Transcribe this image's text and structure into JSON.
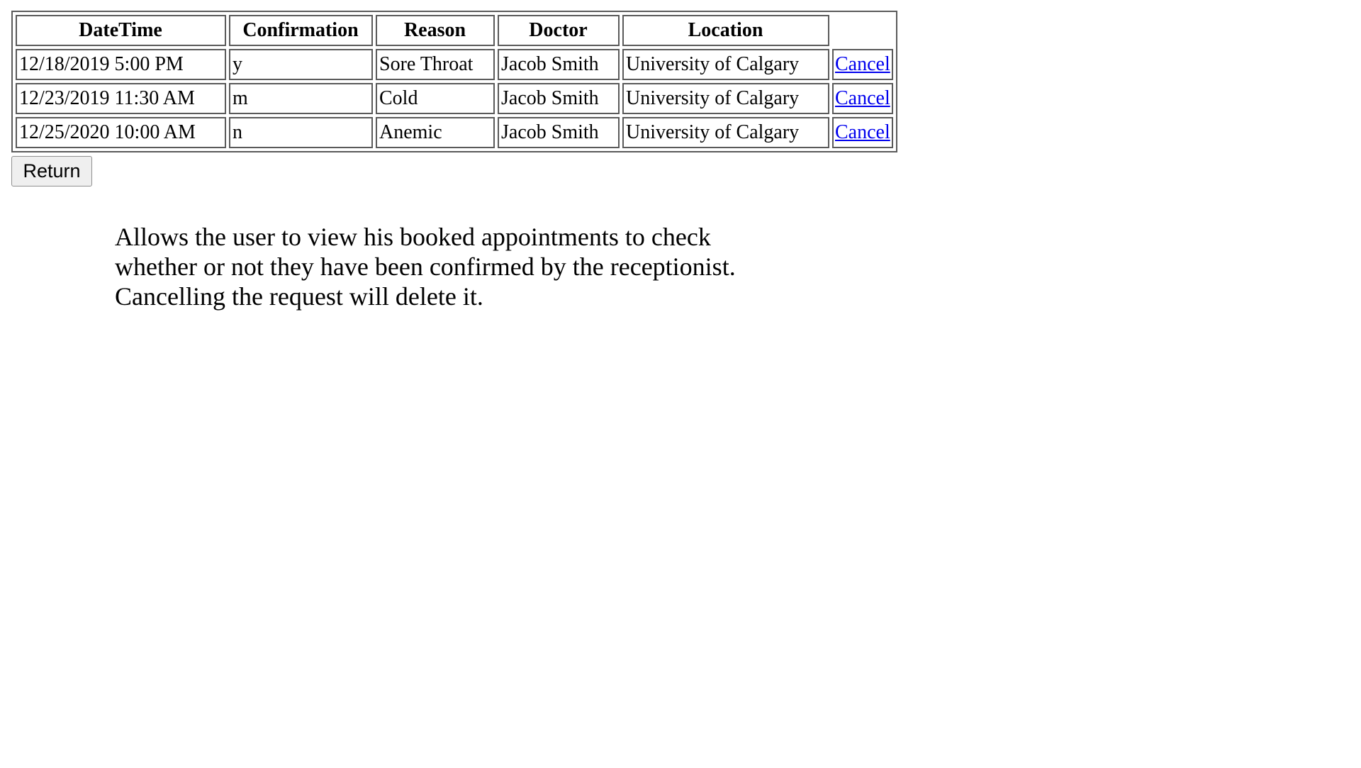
{
  "table": {
    "headers": [
      "DateTime",
      "Confirmation",
      "Reason",
      "Doctor",
      "Location",
      ""
    ],
    "rows": [
      {
        "datetime": "12/18/2019 5:00 PM",
        "confirmation": "y",
        "reason": "Sore Throat",
        "doctor": "Jacob Smith",
        "location": "University of Calgary",
        "action": "Cancel"
      },
      {
        "datetime": "12/23/2019 11:30 AM",
        "confirmation": "m",
        "reason": "Cold",
        "doctor": "Jacob Smith",
        "location": "University of Calgary",
        "action": "Cancel"
      },
      {
        "datetime": "12/25/2020 10:00 AM",
        "confirmation": "n",
        "reason": "Anemic",
        "doctor": "Jacob Smith",
        "location": "University of Calgary",
        "action": "Cancel"
      }
    ]
  },
  "return_button": {
    "label": "Return"
  },
  "description": {
    "lines": [
      "Allows the user to view his booked appointments to check",
      "whether or not they have been confirmed by the receptionist.",
      "Cancelling the request will delete it."
    ]
  },
  "colors": {
    "link": "#0000ee",
    "border": "#5a5a5a",
    "button_bg": "#efefef"
  }
}
